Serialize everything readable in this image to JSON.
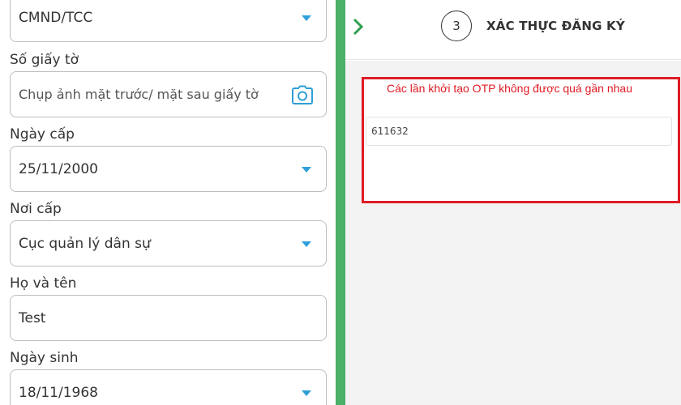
{
  "form": {
    "id_type": {
      "value": "CMND/TCC"
    },
    "doc_number": {
      "label": "Số giấy tờ",
      "placeholder": "Chụp ảnh mặt trước/ mặt sau giấy tờ"
    },
    "issue_date": {
      "label": "Ngày cấp",
      "value": "25/11/2000"
    },
    "issue_place": {
      "label": "Nơi cấp",
      "value": "Cục quản lý dân sự"
    },
    "full_name": {
      "label": "Họ và tên",
      "value": "Test"
    },
    "dob": {
      "label": "Ngày sinh",
      "value": "18/11/1968"
    }
  },
  "step": {
    "number": "3",
    "title": "XÁC THỰC ĐĂNG KÝ"
  },
  "otp": {
    "error": "Các lần khởi tạo OTP không được quá gần nhau",
    "value": "611632"
  },
  "colors": {
    "accent": "#2f9fd8",
    "divider": "#4caf6a",
    "error": "#e01b24"
  },
  "icons": [
    "chevron-down-icon",
    "camera-icon",
    "chevron-right-icon"
  ]
}
